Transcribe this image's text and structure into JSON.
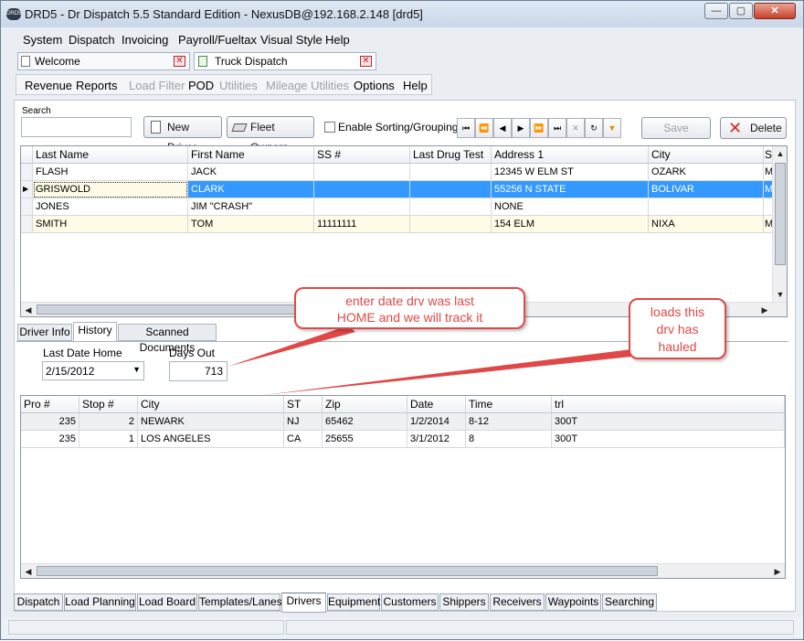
{
  "window": {
    "title": "DRD5 - Dr Dispatch 5.5 Standard Edition - NexusDB@192.168.2.148 [drd5]",
    "icon_text": "DRD5"
  },
  "menu": [
    "System",
    "Dispatch",
    "Invoicing",
    "Payroll/Fueltax",
    "Visual Style",
    "Help"
  ],
  "doc_tabs": [
    {
      "label": "Welcome"
    },
    {
      "label": "Truck Dispatch"
    }
  ],
  "toolbar": {
    "items": [
      {
        "label": "Revenue",
        "enabled": true
      },
      {
        "label": "Reports",
        "enabled": true
      },
      {
        "label": "Load Filter",
        "enabled": false
      },
      {
        "label": "POD",
        "enabled": true
      },
      {
        "label": "Utilities",
        "enabled": false
      },
      {
        "label": "Mileage Utilities",
        "enabled": false
      },
      {
        "label": "Options",
        "enabled": true
      },
      {
        "label": "Help",
        "enabled": true
      }
    ]
  },
  "search": {
    "label": "Search",
    "value": ""
  },
  "buttons": {
    "new_driver": "New Driver",
    "fleet_owners": "Fleet Owners",
    "sorting": "Enable Sorting/Grouping",
    "save": "Save",
    "delete": "Delete"
  },
  "drivers_grid": {
    "columns": [
      "Last Name",
      "First Name",
      "SS #",
      "Last Drug Test",
      "Address 1",
      "City",
      "S"
    ],
    "rows": [
      [
        "FLASH",
        "JACK",
        "",
        "",
        "12345 W ELM ST",
        "OZARK",
        "M"
      ],
      [
        "GRISWOLD",
        "CLARK",
        "",
        "",
        "55256 N STATE",
        "BOLIVAR",
        "M"
      ],
      [
        "JONES",
        "JIM \"CRASH\"",
        "",
        "",
        "NONE",
        "",
        ""
      ],
      [
        "SMITH",
        "TOM",
        "11111111",
        "",
        "154 ELM",
        "NIXA",
        "M"
      ]
    ],
    "selected_row": 1
  },
  "sub_tabs": [
    {
      "label": "Driver Info"
    },
    {
      "label": "History"
    },
    {
      "label": "Scanned Documents"
    }
  ],
  "history": {
    "last_date_home_label": "Last Date Home",
    "last_date_home": "2/15/2012",
    "days_out_label": "Days Out",
    "days_out": "713"
  },
  "loads_grid": {
    "columns": [
      "Pro #",
      "Stop #",
      "City",
      "ST",
      "Zip",
      "Date",
      "Time",
      "trl"
    ],
    "rows": [
      [
        "235",
        "2",
        "NEWARK",
        "NJ",
        "65462",
        "1/2/2014",
        "8-12",
        "300T"
      ],
      [
        "235",
        "1",
        "LOS ANGELES",
        "CA",
        "25655",
        "3/1/2012",
        "8",
        "300T"
      ]
    ]
  },
  "callouts": {
    "home": "enter date drv was last HOME and we will track it",
    "loads": "loads this drv has hauled"
  },
  "bottom_tabs": [
    "Dispatch",
    "Load Planning",
    "Load Board",
    "Templates/Lanes",
    "Drivers",
    "Equipment",
    "Customers",
    "Shippers",
    "Receivers",
    "Waypoints",
    "Searching"
  ],
  "active_bottom_tab": "Drivers",
  "colors": {
    "selection": "#3399ff",
    "callout": "#e04848",
    "alt_row": "#fffbe6"
  }
}
